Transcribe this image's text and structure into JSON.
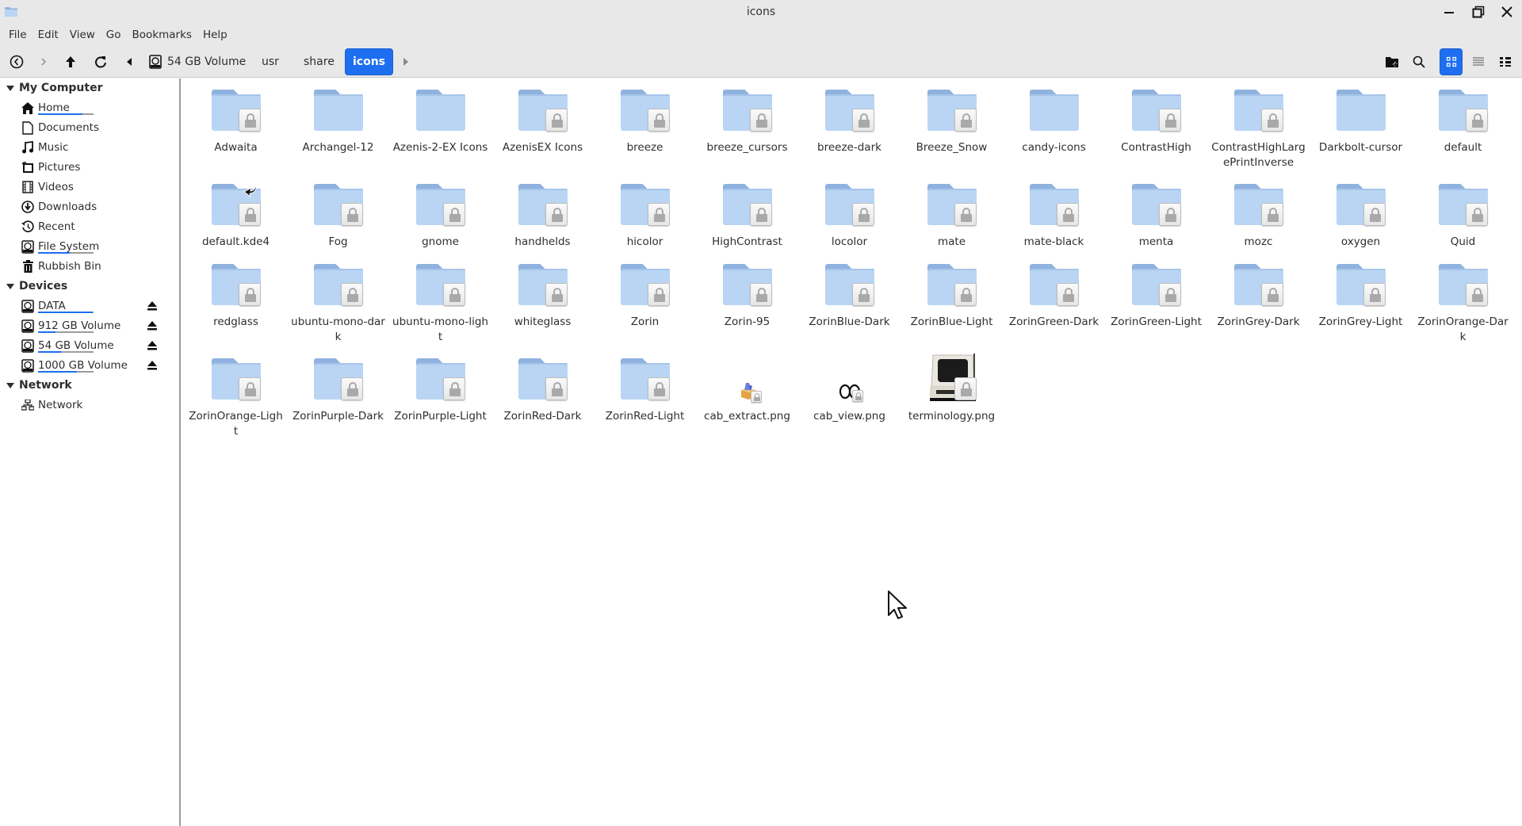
{
  "window": {
    "title": "icons",
    "controls": [
      "minimize",
      "maximize",
      "close"
    ]
  },
  "menubar": {
    "items": [
      "File",
      "Edit",
      "View",
      "Go",
      "Bookmarks",
      "Help"
    ]
  },
  "toolbar": {
    "nav_buttons": [
      "history-back",
      "forward",
      "up",
      "reload",
      "breadcrumb-left"
    ],
    "breadcrumb": [
      {
        "label": "54 GB Volume",
        "icon": "drive-icon",
        "active": false
      },
      {
        "label": "usr",
        "active": false
      },
      {
        "label": "share",
        "active": false
      },
      {
        "label": "icons",
        "active": true
      }
    ],
    "right_buttons": [
      "new-folder",
      "search",
      "icon-view",
      "list-view",
      "compact-view"
    ],
    "active_view": "icon-view",
    "accent_color": "#1e6ff0"
  },
  "sidebar": {
    "sections": [
      {
        "title": "My Computer",
        "items": [
          {
            "label": "Home",
            "icon": "home-icon",
            "usage": 0.8
          },
          {
            "label": "Documents",
            "icon": "document-icon"
          },
          {
            "label": "Music",
            "icon": "music-icon"
          },
          {
            "label": "Pictures",
            "icon": "pictures-icon"
          },
          {
            "label": "Videos",
            "icon": "videos-icon"
          },
          {
            "label": "Downloads",
            "icon": "download-icon"
          },
          {
            "label": "Recent",
            "icon": "recent-icon"
          },
          {
            "label": "File System",
            "icon": "drive-icon",
            "usage": 0.57
          },
          {
            "label": "Rubbish Bin",
            "icon": "trash-icon"
          }
        ]
      },
      {
        "title": "Devices",
        "items": [
          {
            "label": "DATA",
            "icon": "drive-icon",
            "usage": 0.99,
            "eject": true
          },
          {
            "label": "912 GB Volume",
            "icon": "drive-icon",
            "usage": 0.32,
            "eject": true
          },
          {
            "label": "54 GB Volume",
            "icon": "drive-icon",
            "usage": 0.42,
            "eject": true
          },
          {
            "label": "1000 GB Volume",
            "icon": "drive-icon",
            "usage": 0.7,
            "eject": true
          }
        ]
      },
      {
        "title": "Network",
        "items": [
          {
            "label": "Network",
            "icon": "network-icon"
          }
        ]
      }
    ]
  },
  "files": [
    {
      "name": "Adwaita",
      "type": "folder",
      "locked": true
    },
    {
      "name": "Archangel-12",
      "type": "folder",
      "locked": false
    },
    {
      "name": "Azenis-2-EX Icons",
      "type": "folder",
      "locked": false
    },
    {
      "name": "AzenisEX Icons",
      "type": "folder",
      "locked": true
    },
    {
      "name": "breeze",
      "type": "folder",
      "locked": true
    },
    {
      "name": "breeze_cursors",
      "type": "folder",
      "locked": true
    },
    {
      "name": "breeze-dark",
      "type": "folder",
      "locked": true
    },
    {
      "name": "Breeze_Snow",
      "type": "folder",
      "locked": true
    },
    {
      "name": "candy-icons",
      "type": "folder",
      "locked": false
    },
    {
      "name": "ContrastHigh",
      "type": "folder",
      "locked": true
    },
    {
      "name": "ContrastHighLargePrintInverse",
      "type": "folder",
      "locked": true
    },
    {
      "name": "Darkbolt-cursor",
      "type": "folder",
      "locked": false
    },
    {
      "name": "default",
      "type": "folder",
      "locked": true
    },
    {
      "name": "default.kde4",
      "type": "folder",
      "locked": true,
      "symlink": true
    },
    {
      "name": "Fog",
      "type": "folder",
      "locked": true
    },
    {
      "name": "gnome",
      "type": "folder",
      "locked": true
    },
    {
      "name": "handhelds",
      "type": "folder",
      "locked": true
    },
    {
      "name": "hicolor",
      "type": "folder",
      "locked": true
    },
    {
      "name": "HighContrast",
      "type": "folder",
      "locked": true
    },
    {
      "name": "locolor",
      "type": "folder",
      "locked": true
    },
    {
      "name": "mate",
      "type": "folder",
      "locked": true
    },
    {
      "name": "mate-black",
      "type": "folder",
      "locked": true
    },
    {
      "name": "menta",
      "type": "folder",
      "locked": true
    },
    {
      "name": "mozc",
      "type": "folder",
      "locked": true
    },
    {
      "name": "oxygen",
      "type": "folder",
      "locked": true
    },
    {
      "name": "Quid",
      "type": "folder",
      "locked": true
    },
    {
      "name": "redglass",
      "type": "folder",
      "locked": true
    },
    {
      "name": "ubuntu-mono-dark",
      "type": "folder",
      "locked": true
    },
    {
      "name": "ubuntu-mono-light",
      "type": "folder",
      "locked": true
    },
    {
      "name": "whiteglass",
      "type": "folder",
      "locked": true
    },
    {
      "name": "Zorin",
      "type": "folder",
      "locked": true
    },
    {
      "name": "Zorin-95",
      "type": "folder",
      "locked": true
    },
    {
      "name": "ZorinBlue-Dark",
      "type": "folder",
      "locked": true
    },
    {
      "name": "ZorinBlue-Light",
      "type": "folder",
      "locked": true
    },
    {
      "name": "ZorinGreen-Dark",
      "type": "folder",
      "locked": true
    },
    {
      "name": "ZorinGreen-Light",
      "type": "folder",
      "locked": true
    },
    {
      "name": "ZorinGrey-Dark",
      "type": "folder",
      "locked": true
    },
    {
      "name": "ZorinGrey-Light",
      "type": "folder",
      "locked": true
    },
    {
      "name": "ZorinOrange-Dark",
      "type": "folder",
      "locked": true
    },
    {
      "name": "ZorinOrange-Light",
      "type": "folder",
      "locked": true
    },
    {
      "name": "ZorinPurple-Dark",
      "type": "folder",
      "locked": true
    },
    {
      "name": "ZorinPurple-Light",
      "type": "folder",
      "locked": true
    },
    {
      "name": "ZorinRed-Dark",
      "type": "folder",
      "locked": true
    },
    {
      "name": "ZorinRed-Light",
      "type": "folder",
      "locked": true
    },
    {
      "name": "cab_extract.png",
      "type": "image",
      "thumb": "package",
      "locked": true
    },
    {
      "name": "cab_view.png",
      "type": "image",
      "thumb": "glasses",
      "locked": true
    },
    {
      "name": "terminology.png",
      "type": "image",
      "thumb": "terminal",
      "locked": true
    }
  ],
  "colors": {
    "folder_body": "#b9d5f3",
    "folder_tab": "#8fb2de",
    "accent": "#1e6ff0",
    "chrome_bg": "#e8e8e8"
  }
}
